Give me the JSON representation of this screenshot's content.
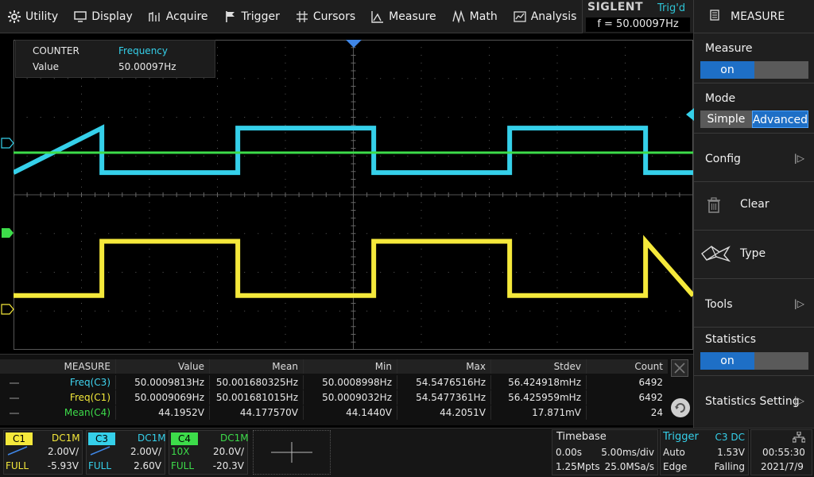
{
  "menu": [
    {
      "name": "utility",
      "label": "Utility",
      "icon": "gear-icon"
    },
    {
      "name": "display",
      "label": "Display",
      "icon": "monitor-icon"
    },
    {
      "name": "acquire",
      "label": "Acquire",
      "icon": "acquire-icon"
    },
    {
      "name": "trigger",
      "label": "Trigger",
      "icon": "flag-icon"
    },
    {
      "name": "cursors",
      "label": "Cursors",
      "icon": "crosshair-icon"
    },
    {
      "name": "measure",
      "label": "Measure",
      "icon": "measure-icon"
    },
    {
      "name": "math",
      "label": "Math",
      "icon": "math-icon"
    },
    {
      "name": "analysis",
      "label": "Analysis",
      "icon": "analysis-icon"
    }
  ],
  "brand": {
    "logo": "SIGLENT",
    "status": "Trig'd",
    "frequency": "f = 50.00097Hz"
  },
  "panel": {
    "title": "MEASURE",
    "measure": {
      "label": "Measure",
      "value": "on"
    },
    "mode": {
      "label": "Mode",
      "options": [
        "Simple",
        "Advanced"
      ],
      "selected": "Advanced"
    },
    "config": "Config",
    "clear": "Clear",
    "type": "Type",
    "tools": "Tools",
    "statistics": {
      "label": "Statistics",
      "value": "on"
    },
    "statistics_setting": "Statistics Setting"
  },
  "counter": {
    "title": "COUNTER",
    "mode": "Frequency",
    "value_label": "Value",
    "value": "50.00097Hz"
  },
  "measure_table": {
    "columns": [
      "MEASURE",
      "Value",
      "Mean",
      "Min",
      "Max",
      "Stdev",
      "Count"
    ],
    "rows": [
      {
        "name": "Freq(C3)",
        "color": "#3fd3ee",
        "values": [
          "50.0009813Hz",
          "50.001680325Hz",
          "50.0008998Hz",
          "54.5476516Hz",
          "56.424918mHz",
          "6492"
        ]
      },
      {
        "name": "Freq(C1)",
        "color": "#f2e83a",
        "values": [
          "50.0009069Hz",
          "50.001681015Hz",
          "50.0009032Hz",
          "54.5477361Hz",
          "56.425959mHz",
          "6492"
        ]
      },
      {
        "name": "Mean(C4)",
        "color": "#3ddc4a",
        "values": [
          "44.1952V",
          "44.177570V",
          "44.1440V",
          "44.2051V",
          "17.871mV",
          "24"
        ]
      }
    ]
  },
  "channels": [
    {
      "label": "C1",
      "color": "#f5e93b",
      "coupling": "DC1M",
      "probe": "",
      "scale": "2.00V/",
      "bw": "FULL",
      "offset": "-5.93V"
    },
    {
      "label": "C3",
      "color": "#35d0ea",
      "coupling": "DC1M",
      "probe": "",
      "scale": "2.00V/",
      "bw": "FULL",
      "offset": "2.60V"
    },
    {
      "label": "C4",
      "color": "#3ddc4a",
      "coupling": "DC1M",
      "probe": "10X",
      "scale": "20.0V/",
      "bw": "FULL",
      "offset": "-20.3V"
    }
  ],
  "timebase": {
    "title": "Timebase",
    "delay": "0.00s",
    "scale": "5.00ms/div",
    "memory": "1.25Mpts",
    "sample_rate": "25.0MSa/s"
  },
  "trigger": {
    "title": "Trigger",
    "source": "C3 DC",
    "mode": "Auto",
    "level": "1.53V",
    "type": "Edge",
    "slope": "Falling"
  },
  "clock": {
    "time": "00:55:30",
    "date": "2021/7/9"
  },
  "colors": {
    "c1": "#f5e93b",
    "c3": "#35d0ea",
    "c4": "#3ddc4a",
    "accent": "#1e6fc6"
  },
  "waveforms": {
    "time_per_div_ms": 5,
    "c3": {
      "period_ms": 20,
      "first_rise_div": 3.3,
      "high_div": 2.5,
      "low_div": 1.25
    },
    "c1": {
      "period_ms": 20,
      "first_rise_div": 1.3,
      "high_div": 2.5,
      "low_div": 1.25
    },
    "c4": {
      "level_div": 1.6
    }
  }
}
